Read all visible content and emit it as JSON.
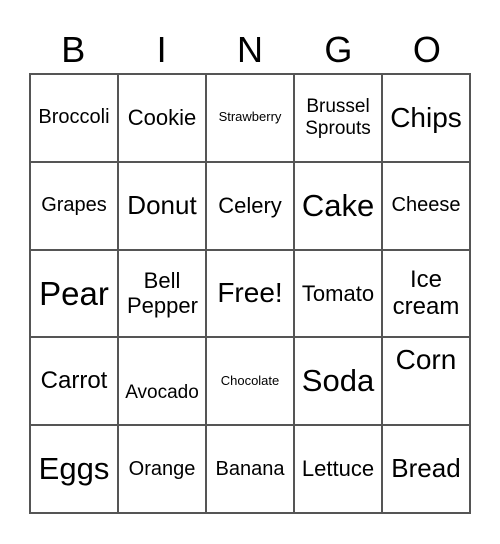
{
  "header": [
    "B",
    "I",
    "N",
    "G",
    "O"
  ],
  "cells": [
    [
      "Broccoli",
      "Cookie",
      "Strawberry",
      "Brussel Sprouts",
      "Chips"
    ],
    [
      "Grapes",
      "Donut",
      "Celery",
      "Cake",
      "Cheese"
    ],
    [
      "Pear",
      "Bell Pepper",
      "Free!",
      "Tomato",
      "Ice cream"
    ],
    [
      "Carrot",
      "Avocado",
      "Chocolate",
      "Soda",
      "Corn"
    ],
    [
      "Eggs",
      "Orange",
      "Banana",
      "Lettuce",
      "Bread"
    ]
  ]
}
